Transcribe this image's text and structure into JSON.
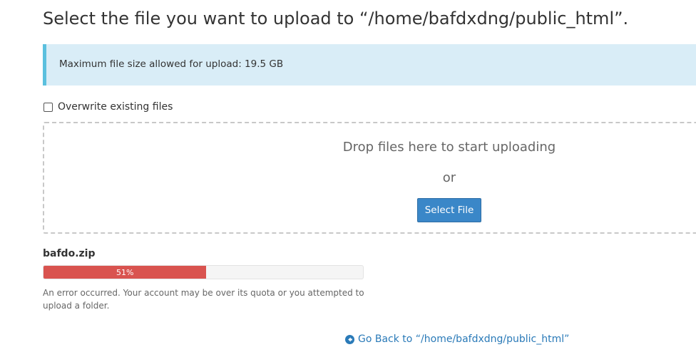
{
  "page_title": "Select the file you want to upload to “/home/bafdxdng/public_html”.",
  "info": {
    "max_size_text": "Maximum file size allowed for upload: 19.5 GB"
  },
  "overwrite": {
    "label": "Overwrite existing files",
    "checked": false
  },
  "dropzone": {
    "drop_text": "Drop files here to start uploading",
    "or_text": "or",
    "select_button_label": "Select File"
  },
  "upload": {
    "file_name": "bafdo.zip",
    "progress_percent": 51,
    "progress_label": "51%",
    "status_color": "#d9534f",
    "error_message": "An error occurred. Your account may be over its quota or you attempted to upload a folder."
  },
  "back_link": {
    "label": "Go Back to “/home/bafdxdng/public_html”",
    "icon": "arrow-circle-left-icon"
  },
  "colors": {
    "info_background": "#d9edf7",
    "info_border": "#5bc0de",
    "button_primary": "#3a87c8",
    "link": "#2a7ab8"
  }
}
